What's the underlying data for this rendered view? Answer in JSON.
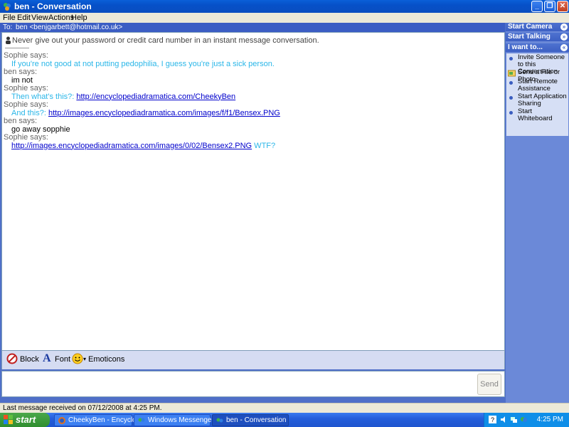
{
  "window": {
    "title": "ben - Conversation",
    "menu": [
      "File",
      "Edit",
      "View",
      "Actions",
      "Help"
    ]
  },
  "to_bar": {
    "label": "To:",
    "recipient": "ben <benjgarbett@hotmail.co.uk>"
  },
  "chat": {
    "notice": "Never give out your password or credit card number in an instant message conversation.",
    "messages": [
      {
        "sender": "Sophie says:",
        "parts": [
          {
            "text": "If you're not good at not putting pedophilia, I guess you're just a sick person.",
            "style": "blue"
          }
        ]
      },
      {
        "sender": "ben says:",
        "parts": [
          {
            "text": "im not",
            "style": "black"
          }
        ]
      },
      {
        "sender": "Sophie says:",
        "parts": [
          {
            "text": "Then what's this?: ",
            "style": "blue"
          },
          {
            "text": "http://encyclopediadramatica.com/CheekyBen",
            "style": "link"
          }
        ]
      },
      {
        "sender": "Sophie says:",
        "parts": [
          {
            "text": "And this?: ",
            "style": "blue"
          },
          {
            "text": "http://images.encyclopediadramatica.com/images/f/f1/Bensex.PNG",
            "style": "link"
          }
        ]
      },
      {
        "sender": "ben says:",
        "parts": [
          {
            "text": "go away sopphie",
            "style": "black"
          }
        ]
      },
      {
        "sender": "Sophie says:",
        "parts": [
          {
            "text": "http://images.encyclopediadramatica.com/images/0/02/Bensex2.PNG",
            "style": "link"
          },
          {
            "text": " WTF?",
            "style": "blue"
          }
        ]
      }
    ]
  },
  "toolbar": {
    "block": "Block",
    "font": "Font",
    "emoticons": "Emoticons",
    "emoticons_arrow": "▾"
  },
  "input": {
    "send": "Send"
  },
  "side_panel": {
    "start_camera": "Start Camera",
    "start_talking": "Start Talking",
    "i_want_to": "I want to...",
    "items": [
      "Invite Someone to this Conversation",
      "Send a File or Photo",
      "Start Remote Assistance",
      "Start Application Sharing",
      "Start Whiteboard"
    ]
  },
  "status": {
    "text": "Last message received on 07/12/2008 at 4:25 PM."
  },
  "taskbar": {
    "start": "start",
    "buttons": [
      "CheekyBen - Encyclo...",
      "Windows Messenger",
      "ben - Conversation"
    ],
    "clock": "4:25 PM"
  },
  "colors": {
    "blue_text": "#29b6e8",
    "link": "#0000cc",
    "side_panel": "#6b89d8"
  }
}
